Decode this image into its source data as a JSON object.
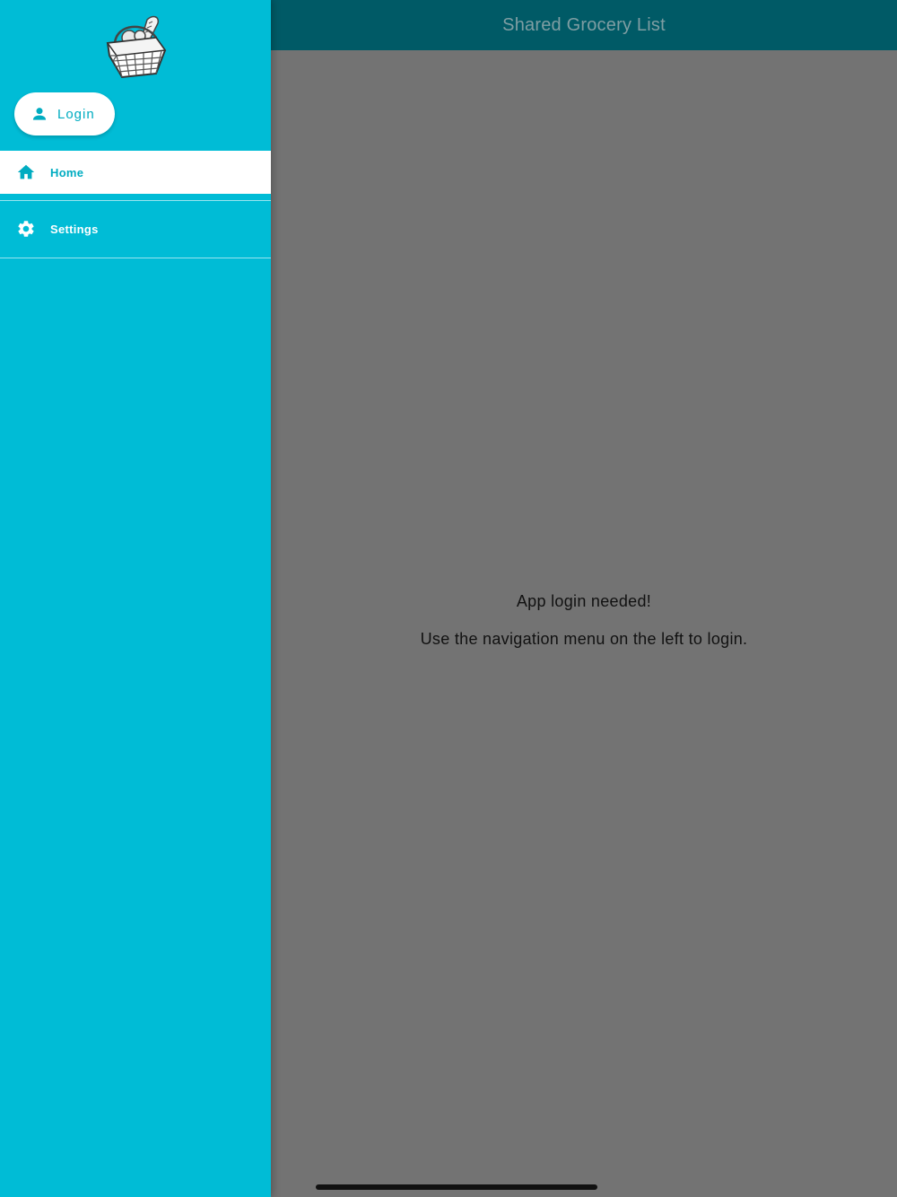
{
  "app": {
    "title": "Shared Grocery List"
  },
  "drawer": {
    "logo_icon": "grocery-basket-icon",
    "login_button": {
      "label": "Login",
      "icon": "person-icon"
    },
    "items": [
      {
        "label": "Home",
        "icon": "home-icon",
        "selected": true
      },
      {
        "label": "Settings",
        "icon": "gear-icon",
        "selected": false
      }
    ]
  },
  "main": {
    "message_title": "App login needed!",
    "message_body": "Use the navigation menu on the left to login."
  },
  "colors": {
    "drawer_background": "#00bcd6",
    "accent": "#00acc1",
    "app_bar": "#005a66",
    "scrim_content": "#737373"
  }
}
